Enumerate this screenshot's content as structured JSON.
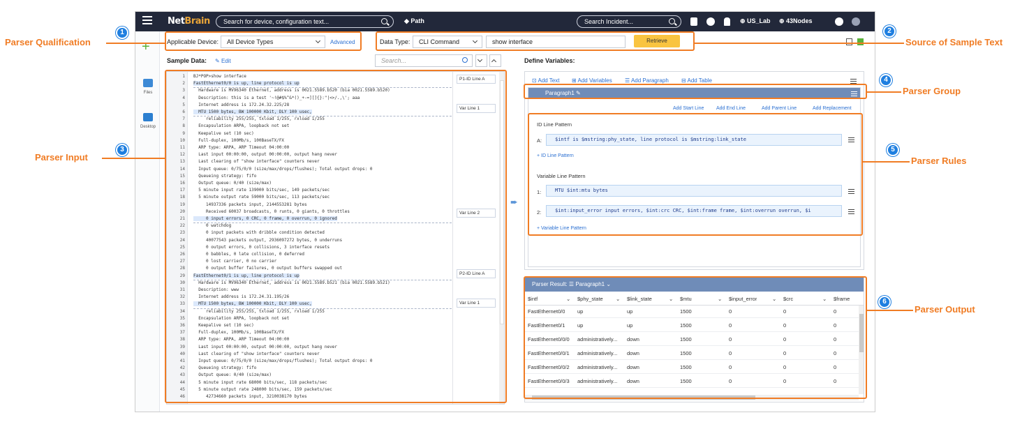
{
  "nav": {
    "logo_a": "Net",
    "logo_b": "Brain",
    "search_placeholder": "Search for device, configuration text...",
    "path_label": "Path",
    "incident_placeholder": "Search Incident...",
    "domain_label": "US_Lab",
    "site_label": "43Nodes"
  },
  "rail": {
    "files_label": "Files",
    "desktop_label": "Desktop"
  },
  "toolbar": {
    "applicable_device_label": "Applicable Device:",
    "device_value": "All Device Types",
    "advanced_label": "Advanced",
    "data_type_label": "Data Type:",
    "data_type_value": "CLI Command",
    "command_value": "show interface",
    "retrieve_label": "Retrieve",
    "sample_data_label": "Sample Data:",
    "edit_label": "Edit",
    "search_placeholder": "Search..."
  },
  "editor": {
    "lines": [
      "BJ*POP>show interface",
      "FastEthernet0/0 is up, line protocol is up",
      "  Hardware is MV96340 Ethernet, address is 0021.5589.b520 (bia 0021.5589.b520)",
      "  Description: this is a test '~!@#$%^&*()_+-=][]{}:\"|<>/.,\\'; aaa",
      "  Internet address is 172.24.32.225/28",
      "  MTU 1500 bytes, BW 100000 Kbit, DLY 100 usec,",
      "     reliability 255/255, txload 1/255, rxload 1/255",
      "  Encapsulation ARPA, loopback not set",
      "  Keepalive set (10 sec)",
      "  Full-duplex, 100Mb/s, 100BaseTX/FX",
      "  ARP type: ARPA, ARP Timeout 04:00:00",
      "  Last input 00:00:00, output 00:00:00, output hang never",
      "  Last clearing of \"show interface\" counters never",
      "  Input queue: 0/75/0/0 (size/max/drops/flushes); Total output drops: 0",
      "  Queueing strategy: fifo",
      "  Output queue: 0/40 (size/max)",
      "  5 minute input rate 139000 bits/sec, 149 packets/sec",
      "  5 minute output rate 59000 bits/sec, 113 packets/sec",
      "     14937336 packets input, 2144553281 bytes",
      "     Received 60037 broadcasts, 0 runts, 0 giants, 0 throttles",
      "     0 input errors, 0 CRC, 0 frame, 0 overrun, 0 ignored",
      "     0 watchdog",
      "     0 input packets with dribble condition detected",
      "     40077543 packets output, 2936097272 bytes, 0 underruns",
      "     0 output errors, 0 collisions, 3 interface resets",
      "     0 babbles, 0 late collision, 0 deferred",
      "     0 lost carrier, 0 no carrier",
      "     0 output buffer failures, 0 output buffers swapped out",
      "FastEthernet0/1 is up, line protocol is up",
      "  Hardware is MV96340 Ethernet, address is 0021.5589.b521 (bia 0021.5589.b521)",
      "  Description: www",
      "  Internet address is 172.24.31.195/26",
      "  MTU 1500 bytes, BW 100000 Kbit, DLY 100 usec,",
      "     reliability 255/255, txload 1/255, rxload 1/255",
      "  Encapsulation ARPA, loopback not set",
      "  Keepalive set (10 sec)",
      "  Full-duplex, 100Mb/s, 100BaseTX/FX",
      "  ARP type: ARPA, ARP Timeout 04:00:00",
      "  Last input 00:00:00, output 00:00:00, output hang never",
      "  Last clearing of \"show interface\" counters never",
      "  Input queue: 0/75/0/0 (size/max/drops/flushes); Total output drops: 0",
      "  Queueing strategy: fifo",
      "  Output queue: 0/40 (size/max)",
      "  5 minute input rate 68000 bits/sec, 118 packets/sec",
      "  5 minute output rate 248000 bits/sec, 159 packets/sec",
      "     42734660 packets input, 3210038170 bytes"
    ],
    "tags": [
      "P1-ID Line A",
      "Var Line 1",
      "Var Line 2",
      "P2-ID Line A",
      "Var Line 1"
    ]
  },
  "define": {
    "title": "Define Variables:",
    "add_text": "Add Text",
    "add_variables": "Add Variables",
    "add_paragraph": "Add Paragraph",
    "add_table": "Add Table",
    "paragraph_label": "Paragraph1",
    "add_start_line": "Add Start Line",
    "add_end_line": "Add End Line",
    "add_parent_line": "Add Parent Line",
    "add_replacement": "Add Replacement",
    "id_section": "ID Line Pattern",
    "id_prefix": "A:",
    "id_pattern": "$intf is $mstring:phy_state, line protocol is $mstring:link_state",
    "add_id_pattern": "+ ID Line Pattern",
    "var_section": "Variable Line Pattern",
    "var1_prefix": "1:",
    "var1_pattern": "MTU $int:mtu bytes",
    "var2_prefix": "2:",
    "var2_pattern": "$int:input_error input errors, $int:crc CRC, $int:frame frame, $int:overrun overrun, $i",
    "add_var_pattern": "+ Variable Line Pattern"
  },
  "result": {
    "title": "Parser Result:",
    "paragraph_label": "Paragraph1",
    "columns": [
      "$intf",
      "$phy_state",
      "$link_state",
      "$mtu",
      "$input_error",
      "$crc",
      "$frame"
    ],
    "rows": [
      [
        "FastEthernet0/0",
        "up",
        "up",
        "1500",
        "0",
        "0",
        "0"
      ],
      [
        "FastEthernet0/1",
        "up",
        "up",
        "1500",
        "0",
        "0",
        "0"
      ],
      [
        "FastEthernet0/0/0",
        "administratively...",
        "down",
        "1500",
        "0",
        "0",
        "0"
      ],
      [
        "FastEthernet0/0/1",
        "administratively...",
        "down",
        "1500",
        "0",
        "0",
        "0"
      ],
      [
        "FastEthernet0/0/2",
        "administratively...",
        "down",
        "1500",
        "0",
        "0",
        "0"
      ],
      [
        "FastEthernet0/0/3",
        "administratively...",
        "down",
        "1500",
        "0",
        "0",
        "0"
      ]
    ]
  },
  "callouts": {
    "c1": "Parser Qualification",
    "c2": "Source of Sample Text",
    "c3": "Parser Input",
    "c4": "Parser Group",
    "c5": "Parser Rules",
    "c6": "Parser Output",
    "n1": "1",
    "n2": "2",
    "n3": "3",
    "n4": "4",
    "n5": "5",
    "n6": "6"
  },
  "colors": {
    "accent_orange": "#f07c24",
    "badge_blue": "#1f7fe0",
    "nav_bg": "#22283a",
    "retrieve_yellow": "#f9c440"
  }
}
